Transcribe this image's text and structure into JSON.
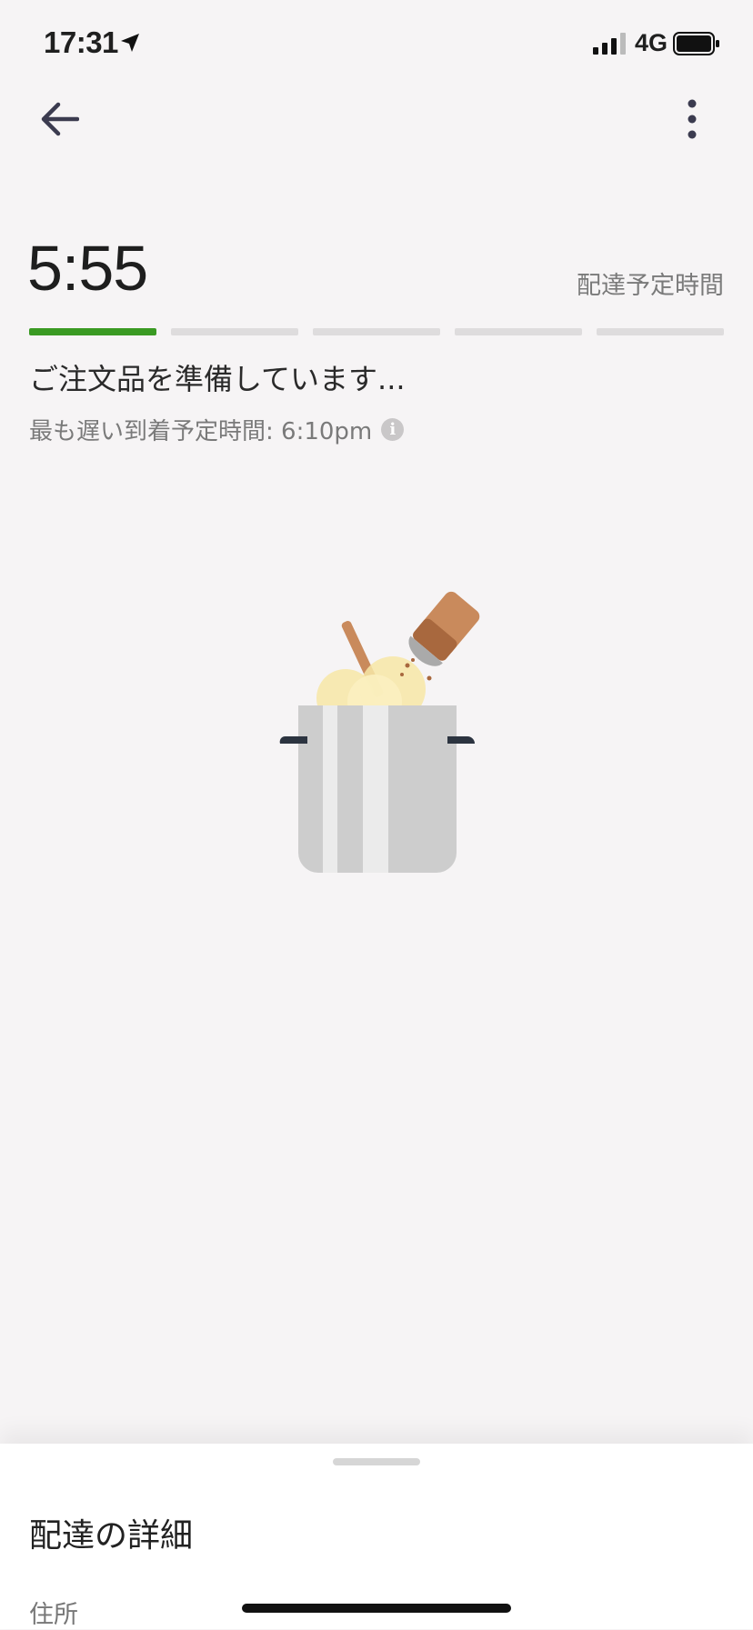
{
  "status_bar": {
    "time": "17:31",
    "network": "4G",
    "location_icon": "location-arrow-icon",
    "signal_icon": "cellular-signal-icon",
    "battery_icon": "battery-icon"
  },
  "nav": {
    "back_icon": "back-arrow-icon",
    "more_icon": "more-vertical-icon"
  },
  "eta": {
    "time": "5:55",
    "label": "配達予定時間"
  },
  "progress": {
    "steps_total": 5,
    "steps_completed": 1,
    "active_color": "#3a9a23",
    "inactive_color": "#dedcdd"
  },
  "order_status": {
    "message": "ご注文品を準備しています...",
    "latest_arrival": "最も遅い到着予定時間: 6:10pm",
    "info_icon": "info-icon"
  },
  "illustration": {
    "icon": "cooking-pot-illustration"
  },
  "sheet": {
    "title": "配達の詳細",
    "address_label": "住所"
  }
}
